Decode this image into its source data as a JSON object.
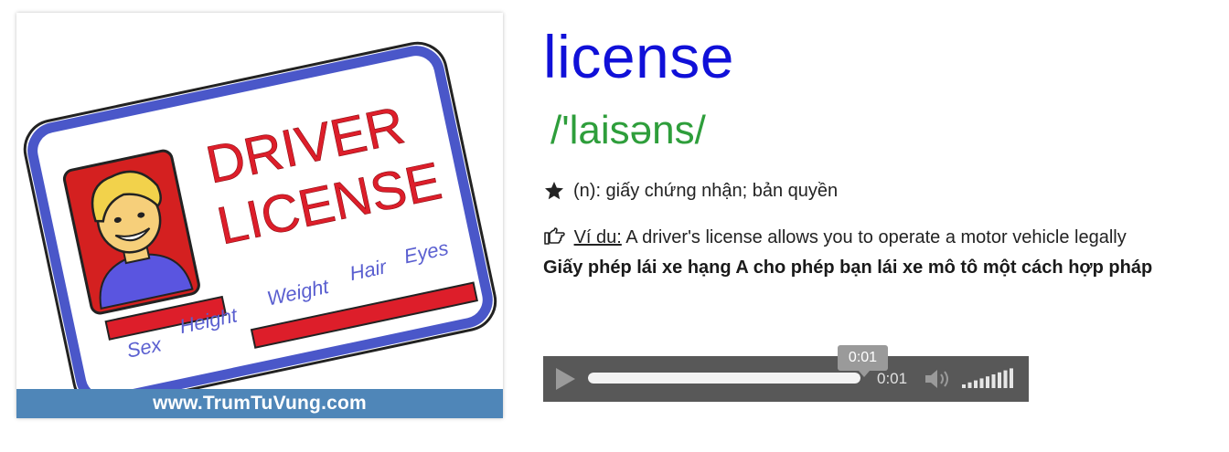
{
  "image": {
    "card_title_line1": "DRIVER",
    "card_title_line2": "LICENSE",
    "field_labels": [
      "Sex",
      "Height",
      "Weight",
      "Hair",
      "Eyes"
    ],
    "watermark": "www.TrumTuVung.com"
  },
  "entry": {
    "word": "license",
    "phonetic": "/'laisəns/",
    "meaning": "(n): giấy chứng nhận; bản quyền",
    "example_label": "Ví du:",
    "example_text": "A driver's license allows you to operate a motor vehicle legally",
    "translation": "Giấy phép lái xe hạng A cho phép bạn lái xe mô tô một cách hợp pháp"
  },
  "audio": {
    "tooltip_time": "0:01",
    "current_time": "0:01",
    "progress": 1.0,
    "volume_level": 1.0
  },
  "colors": {
    "word": "#1010d8",
    "phonetic": "#2e9e3b",
    "card_red": "#dd1e2a",
    "card_border": "#4a57c9",
    "watermark_bar": "#4f86b8",
    "player_bg": "#585858"
  },
  "icons": {
    "meaning": "star-icon",
    "example": "pointing-hand-icon",
    "play": "play-icon",
    "volume": "speaker-icon"
  }
}
